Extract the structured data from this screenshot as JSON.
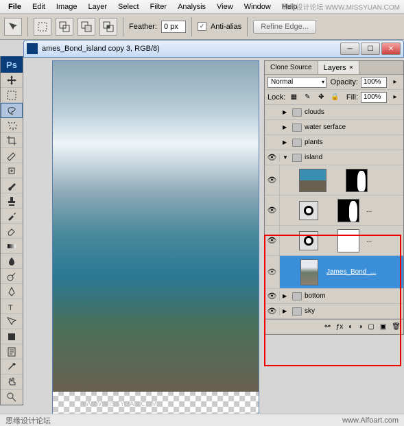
{
  "menu": {
    "items": [
      "File",
      "Edit",
      "Image",
      "Layer",
      "Select",
      "Filter",
      "Analysis",
      "View",
      "Window",
      "Help"
    ]
  },
  "watermark_top": "思缘设计论坛  WWW.MISSYUAN.COM",
  "options": {
    "feather_label": "Feather:",
    "feather_value": "0 px",
    "antialias_label": "Anti-alias",
    "refine_label": "Refine Edge..."
  },
  "doc": {
    "title": "ames_Bond_island copy 3, RGB/8)"
  },
  "panel": {
    "tabs": [
      "Clone Source",
      "Layers"
    ],
    "blend": "Normal",
    "opacity_label": "Opacity:",
    "opacity_value": "100%",
    "lock_label": "Lock:",
    "fill_label": "Fill:",
    "fill_value": "100%"
  },
  "layers": {
    "g0": "clouds",
    "g1": "water serface",
    "g2": "plants",
    "g3": "island",
    "selname": "James_Bond_...",
    "adjdots": "...",
    "g4": "bottom",
    "g5": "sky"
  },
  "footer": {
    "left": "思缘设计论坛",
    "right": "www.Alfoart.com"
  },
  "wm2": "WWW.MISSYUAN.COM"
}
